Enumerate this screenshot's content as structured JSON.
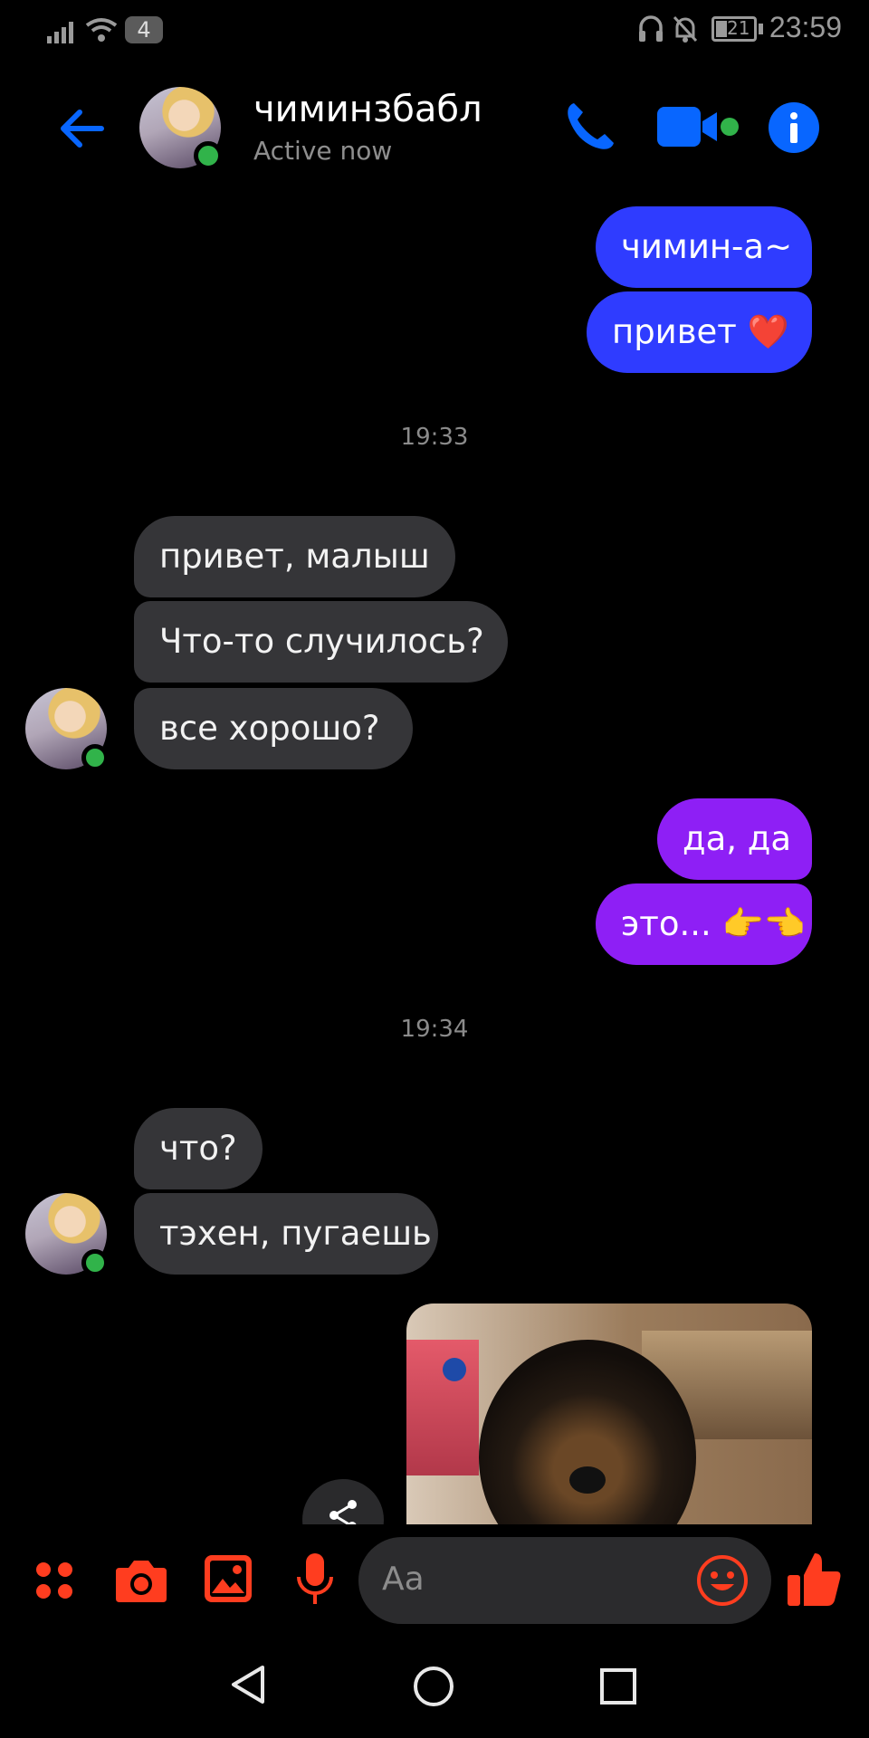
{
  "status_bar": {
    "sim_number": "4",
    "battery": "21",
    "time": "23:59"
  },
  "header": {
    "contact_name": "чиминзбабл",
    "presence": "Active now"
  },
  "messages": [
    {
      "from": "me",
      "text": "чимин-а~"
    },
    {
      "from": "me",
      "text": "привет ❤️"
    },
    {
      "type": "timestamp",
      "text": "19:33"
    },
    {
      "from": "them",
      "text": "привет, малыш"
    },
    {
      "from": "them",
      "text": "Что-то случилось?"
    },
    {
      "from": "them",
      "text": "все хорошо?"
    },
    {
      "from": "me",
      "text": "да, да"
    },
    {
      "from": "me",
      "text": "это... 👉👈"
    },
    {
      "type": "timestamp",
      "text": "19:34"
    },
    {
      "from": "them",
      "text": "что?"
    },
    {
      "from": "them",
      "text": "тэхен, пугаешь"
    }
  ],
  "composer": {
    "placeholder": "Aa"
  },
  "colors": {
    "accent_header": "#0866ff",
    "composer_accent": "#ff3d1f",
    "bubble_blue": "#2f3cff",
    "bubble_purple": "#8e1ff5",
    "bubble_incoming": "#353538"
  },
  "icons": [
    "back-arrow-icon",
    "phone-icon",
    "video-camera-icon",
    "info-icon",
    "apps-icon",
    "camera-icon",
    "gallery-icon",
    "microphone-icon",
    "emoji-icon",
    "thumbs-up-icon",
    "share-icon",
    "nav-back-icon",
    "nav-home-icon",
    "nav-recents-icon"
  ]
}
